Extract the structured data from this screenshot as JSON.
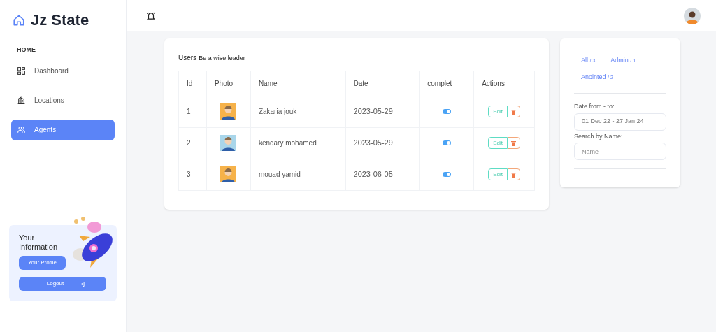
{
  "brand": "Jz State",
  "sidebar": {
    "section": "HOME",
    "items": [
      {
        "label": "Dashboard",
        "selected": false
      },
      {
        "label": "Locations",
        "selected": false
      },
      {
        "label": "Agents",
        "selected": true
      }
    ]
  },
  "info_card": {
    "title": "Your Information",
    "buttons": [
      "Your Profile",
      "Logout"
    ]
  },
  "users": {
    "title": "Users",
    "subtitle": "Be a wise leader",
    "columns": [
      "Id",
      "Photo",
      "Name",
      "Date",
      "complet",
      "Actions"
    ],
    "rows": [
      {
        "id": "1",
        "name": "Zakaria jouk",
        "date": "2023-05-29",
        "complet": true,
        "edit": "Edit"
      },
      {
        "id": "2",
        "name": "kendary mohamed",
        "date": "2023-05-29",
        "complet": true,
        "edit": "Edit"
      },
      {
        "id": "3",
        "name": "mouad yamid",
        "date": "2023-06-05",
        "complet": true,
        "edit": "Edit"
      }
    ]
  },
  "filters": {
    "tabs": [
      {
        "label": "All",
        "count": "/ 3"
      },
      {
        "label": "Admin",
        "count": "/ 1"
      },
      {
        "label": "Anointed",
        "count": "/ 2"
      }
    ],
    "date_label": "Date from - to:",
    "date_value": "01 Dec 22 - 27 Jan 24",
    "name_label": "Search by Name:",
    "name_placeholder": "Name"
  }
}
